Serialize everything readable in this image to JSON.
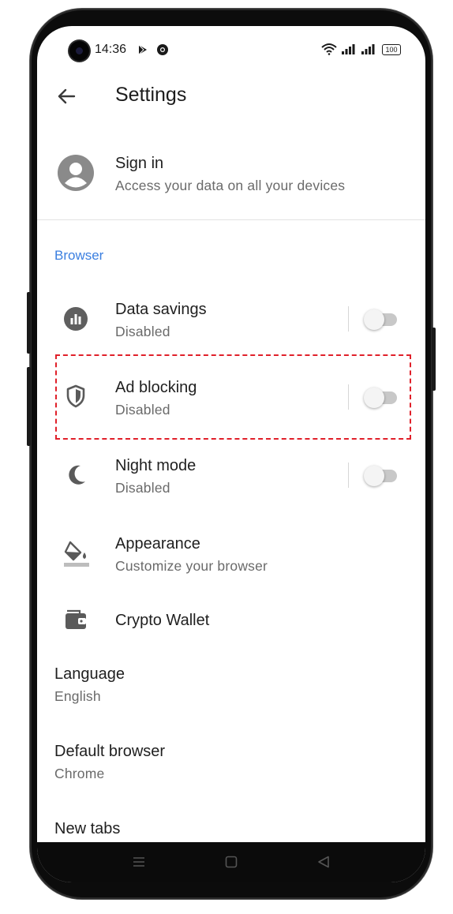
{
  "status_bar": {
    "time": "14:36",
    "battery": "100",
    "icons": [
      "play-store-icon",
      "chrome-icon",
      "wifi-icon",
      "signal-icon",
      "battery-icon"
    ]
  },
  "app_bar": {
    "title": "Settings",
    "back_icon": "arrow-back-icon"
  },
  "account": {
    "title": "Sign in",
    "subtitle": "Access your data on all your devices",
    "icon": "account-circle-icon"
  },
  "browser_section": {
    "header": "Browser",
    "items": [
      {
        "title": "Data savings",
        "subtitle": "Disabled",
        "icon": "data-savings-icon",
        "toggle": false
      },
      {
        "title": "Ad blocking",
        "subtitle": "Disabled",
        "icon": "shield-icon",
        "toggle": false
      },
      {
        "title": "Night mode",
        "subtitle": "Disabled",
        "icon": "moon-icon",
        "toggle": false
      },
      {
        "title": "Appearance",
        "subtitle": "Customize your browser",
        "icon": "paint-bucket-icon"
      },
      {
        "title": "Crypto Wallet",
        "icon": "wallet-icon"
      }
    ]
  },
  "general": {
    "items": [
      {
        "title": "Language",
        "subtitle": "English"
      },
      {
        "title": "Default browser",
        "subtitle": "Chrome"
      },
      {
        "title": "New tabs"
      }
    ]
  },
  "colors": {
    "accent": "#3b7fe0",
    "highlight": "#e0202a",
    "toggle_off": "#c8c8c8"
  },
  "nav_bar": {
    "icons": [
      "menu-icon",
      "home-square-icon",
      "back-triangle-icon"
    ]
  }
}
